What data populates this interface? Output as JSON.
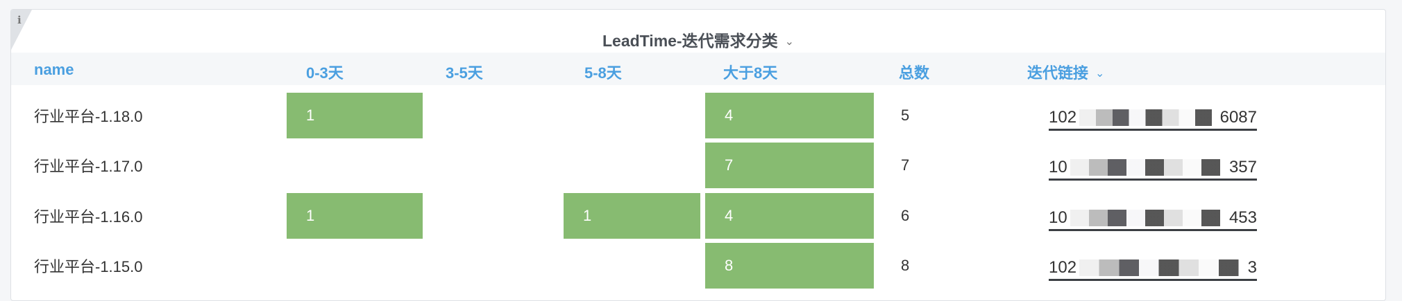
{
  "title": "LeadTime-迭代需求分类",
  "info_icon": "i",
  "columns": [
    "name",
    "0-3天",
    "3-5天",
    "5-8天",
    "大于8天",
    "总数",
    "迭代链接"
  ],
  "colors": {
    "bar": "#87bb71",
    "header_text": "#4a9fe0"
  },
  "rows": [
    {
      "name": "行业平台-1.18.0",
      "d0_3": "1",
      "d3_5": "",
      "d5_8": "",
      "d8": "4",
      "total": "5",
      "link_prefix": "102",
      "link_suffix": "6087"
    },
    {
      "name": "行业平台-1.17.0",
      "d0_3": "",
      "d3_5": "",
      "d5_8": "",
      "d8": "7",
      "total": "7",
      "link_prefix": "10",
      "link_suffix": "357"
    },
    {
      "name": "行业平台-1.16.0",
      "d0_3": "1",
      "d3_5": "",
      "d5_8": "1",
      "d8": "4",
      "total": "6",
      "link_prefix": "10",
      "link_suffix": "453"
    },
    {
      "name": "行业平台-1.15.0",
      "d0_3": "",
      "d3_5": "",
      "d5_8": "",
      "d8": "8",
      "total": "8",
      "link_prefix": "102",
      "link_suffix": "3"
    }
  ]
}
